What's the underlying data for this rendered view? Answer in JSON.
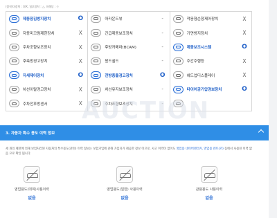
{
  "legend": "(장착/미장착 : 0/X, 일부장착 : △, 미해당 : -)",
  "options": [
    [
      {
        "icon": "abs-icon",
        "label": "제동잠김방지장치",
        "status": "O",
        "active": true
      },
      {
        "icon": "traction-control-icon",
        "label": "자동미끄럼제한장치",
        "status": "X",
        "active": false
      },
      {
        "icon": "parking-camera-icon",
        "label": "주차조향보조장치",
        "status": "X",
        "active": false
      },
      {
        "icon": "rear-warning-icon",
        "label": "후측방경고장치",
        "status": "X",
        "active": false
      },
      {
        "icon": "camera-icon",
        "label": "자세제어장치",
        "status": "O",
        "active": true
      },
      {
        "icon": "lane-departure-icon",
        "label": "차선이탈경고장치",
        "status": "X",
        "active": false
      },
      {
        "icon": "front-sensor-icon",
        "label": "주차전후방센서",
        "status": "X",
        "active": false
      }
    ],
    [
      {
        "icon": "airbag-icon",
        "label": "어라운드뷰",
        "status": "-",
        "active": false
      },
      {
        "icon": "emergency-brake-icon",
        "label": "긴급제동보조장치",
        "status": "-",
        "active": false
      },
      {
        "icon": "cruise-control-icon",
        "label": "후방카메라(BCAM)",
        "status": "-",
        "active": false
      },
      {
        "icon": "night-vision-icon",
        "label": "윈드쉴드",
        "status": "-",
        "active": false
      },
      {
        "icon": "lane-keep-icon",
        "label": "전방충돌경고장치",
        "status": "O",
        "active": true
      },
      {
        "icon": "hud-icon",
        "label": "차선유지보조장치",
        "status": "-",
        "active": false
      },
      {
        "icon": "rear-sensor-icon",
        "label": "주차조향보조장치",
        "status": "-",
        "active": false
      }
    ],
    [
      {
        "icon": "climate-icon",
        "label": "적응형순항제어장치",
        "status": "X",
        "active": false
      },
      {
        "icon": "air-pressure-icon",
        "label": "기면방지장치",
        "status": "X",
        "active": false
      },
      {
        "icon": "tpms-icon",
        "label": "제동보조시스템",
        "status": "O",
        "active": true
      },
      {
        "icon": "parking-assist-icon",
        "label": "주간주행등",
        "status": "X",
        "active": false
      },
      {
        "icon": "headlamp-icon",
        "label": "헤드업디스플레이",
        "status": "X",
        "active": false
      },
      {
        "icon": "tire-pressure-icon",
        "label": "타이어공기압경보장치",
        "status": "O",
        "active": true
      },
      {
        "icon": "blind-spot-icon",
        "label": "",
        "status": "",
        "active": false
      }
    ]
  ],
  "watermark": "AUCTION",
  "section": {
    "title": "3. 자동차 특수 용도 이력 정보"
  },
  "notice": {
    "text": "세 개의 제한에 의해 보험처리된 자동차의 특수용도(관련) 이력 정보는 보험가입에 관해 가입자가 제공한 정보 이므로, 사고 이력이 없어도",
    "link_text": "영업용 네이버렌터카, 영업용 렌트(카)",
    "text2": "등에서 사용된 이력 없음 으로 확인 됩니다."
  },
  "usage": [
    {
      "icon": "commercial-vehicle-icon",
      "label": "영업용도(대여)사용이력",
      "value": "없음"
    },
    {
      "icon": "general-vehicle-icon",
      "label": "영업용도(일반) 사용이력",
      "value": "없음"
    },
    {
      "icon": "government-vehicle-icon",
      "label": "관용용도 사용이력",
      "value": "없음"
    }
  ]
}
